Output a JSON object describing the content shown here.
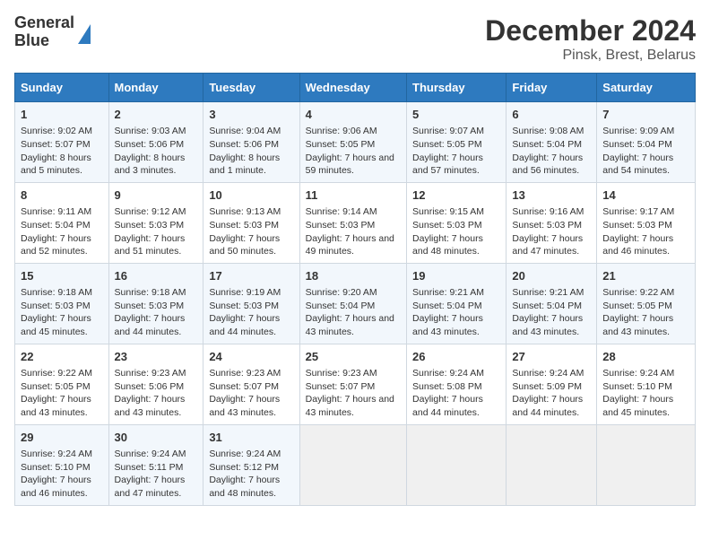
{
  "logo": {
    "line1": "General",
    "line2": "Blue"
  },
  "title": "December 2024",
  "subtitle": "Pinsk, Brest, Belarus",
  "days_of_week": [
    "Sunday",
    "Monday",
    "Tuesday",
    "Wednesday",
    "Thursday",
    "Friday",
    "Saturday"
  ],
  "weeks": [
    [
      {
        "day": "1",
        "sunrise": "9:02 AM",
        "sunset": "5:07 PM",
        "daylight": "8 hours and 5 minutes."
      },
      {
        "day": "2",
        "sunrise": "9:03 AM",
        "sunset": "5:06 PM",
        "daylight": "8 hours and 3 minutes."
      },
      {
        "day": "3",
        "sunrise": "9:04 AM",
        "sunset": "5:06 PM",
        "daylight": "8 hours and 1 minute."
      },
      {
        "day": "4",
        "sunrise": "9:06 AM",
        "sunset": "5:05 PM",
        "daylight": "7 hours and 59 minutes."
      },
      {
        "day": "5",
        "sunrise": "9:07 AM",
        "sunset": "5:05 PM",
        "daylight": "7 hours and 57 minutes."
      },
      {
        "day": "6",
        "sunrise": "9:08 AM",
        "sunset": "5:04 PM",
        "daylight": "7 hours and 56 minutes."
      },
      {
        "day": "7",
        "sunrise": "9:09 AM",
        "sunset": "5:04 PM",
        "daylight": "7 hours and 54 minutes."
      }
    ],
    [
      {
        "day": "8",
        "sunrise": "9:11 AM",
        "sunset": "5:04 PM",
        "daylight": "7 hours and 52 minutes."
      },
      {
        "day": "9",
        "sunrise": "9:12 AM",
        "sunset": "5:03 PM",
        "daylight": "7 hours and 51 minutes."
      },
      {
        "day": "10",
        "sunrise": "9:13 AM",
        "sunset": "5:03 PM",
        "daylight": "7 hours and 50 minutes."
      },
      {
        "day": "11",
        "sunrise": "9:14 AM",
        "sunset": "5:03 PM",
        "daylight": "7 hours and 49 minutes."
      },
      {
        "day": "12",
        "sunrise": "9:15 AM",
        "sunset": "5:03 PM",
        "daylight": "7 hours and 48 minutes."
      },
      {
        "day": "13",
        "sunrise": "9:16 AM",
        "sunset": "5:03 PM",
        "daylight": "7 hours and 47 minutes."
      },
      {
        "day": "14",
        "sunrise": "9:17 AM",
        "sunset": "5:03 PM",
        "daylight": "7 hours and 46 minutes."
      }
    ],
    [
      {
        "day": "15",
        "sunrise": "9:18 AM",
        "sunset": "5:03 PM",
        "daylight": "7 hours and 45 minutes."
      },
      {
        "day": "16",
        "sunrise": "9:18 AM",
        "sunset": "5:03 PM",
        "daylight": "7 hours and 44 minutes."
      },
      {
        "day": "17",
        "sunrise": "9:19 AM",
        "sunset": "5:03 PM",
        "daylight": "7 hours and 44 minutes."
      },
      {
        "day": "18",
        "sunrise": "9:20 AM",
        "sunset": "5:04 PM",
        "daylight": "7 hours and 43 minutes."
      },
      {
        "day": "19",
        "sunrise": "9:21 AM",
        "sunset": "5:04 PM",
        "daylight": "7 hours and 43 minutes."
      },
      {
        "day": "20",
        "sunrise": "9:21 AM",
        "sunset": "5:04 PM",
        "daylight": "7 hours and 43 minutes."
      },
      {
        "day": "21",
        "sunrise": "9:22 AM",
        "sunset": "5:05 PM",
        "daylight": "7 hours and 43 minutes."
      }
    ],
    [
      {
        "day": "22",
        "sunrise": "9:22 AM",
        "sunset": "5:05 PM",
        "daylight": "7 hours and 43 minutes."
      },
      {
        "day": "23",
        "sunrise": "9:23 AM",
        "sunset": "5:06 PM",
        "daylight": "7 hours and 43 minutes."
      },
      {
        "day": "24",
        "sunrise": "9:23 AM",
        "sunset": "5:07 PM",
        "daylight": "7 hours and 43 minutes."
      },
      {
        "day": "25",
        "sunrise": "9:23 AM",
        "sunset": "5:07 PM",
        "daylight": "7 hours and 43 minutes."
      },
      {
        "day": "26",
        "sunrise": "9:24 AM",
        "sunset": "5:08 PM",
        "daylight": "7 hours and 44 minutes."
      },
      {
        "day": "27",
        "sunrise": "9:24 AM",
        "sunset": "5:09 PM",
        "daylight": "7 hours and 44 minutes."
      },
      {
        "day": "28",
        "sunrise": "9:24 AM",
        "sunset": "5:10 PM",
        "daylight": "7 hours and 45 minutes."
      }
    ],
    [
      {
        "day": "29",
        "sunrise": "9:24 AM",
        "sunset": "5:10 PM",
        "daylight": "7 hours and 46 minutes."
      },
      {
        "day": "30",
        "sunrise": "9:24 AM",
        "sunset": "5:11 PM",
        "daylight": "7 hours and 47 minutes."
      },
      {
        "day": "31",
        "sunrise": "9:24 AM",
        "sunset": "5:12 PM",
        "daylight": "7 hours and 48 minutes."
      },
      null,
      null,
      null,
      null
    ]
  ],
  "labels": {
    "sunrise": "Sunrise:",
    "sunset": "Sunset:",
    "daylight": "Daylight:"
  }
}
